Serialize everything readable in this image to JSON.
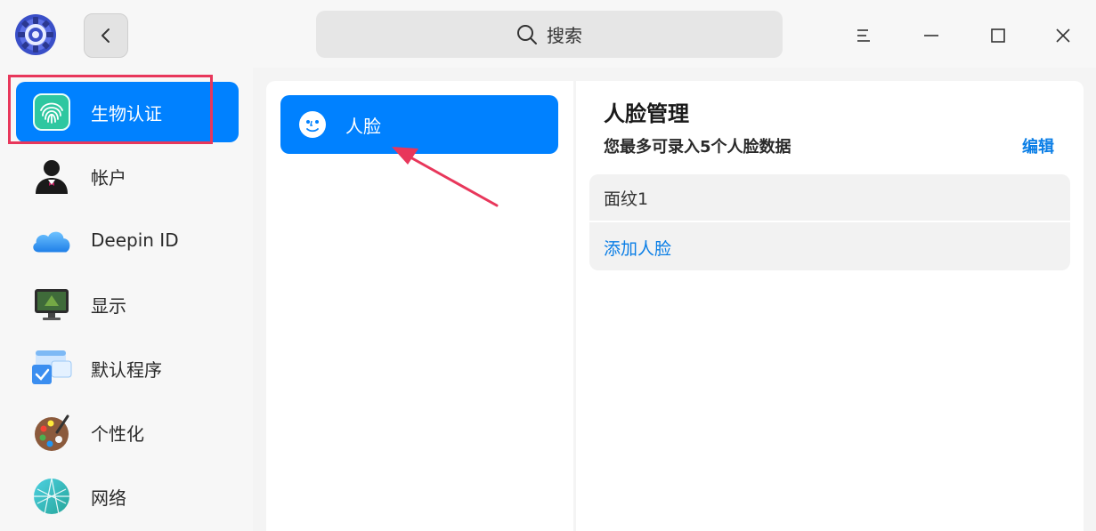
{
  "titlebar": {
    "app_icon": "settings-gear-icon",
    "back_icon": "chevron-left-icon",
    "search_icon": "search-icon",
    "search_placeholder": "搜索",
    "menu_icon": "hamburger-menu-icon",
    "minimize_icon": "minimize-icon",
    "maximize_icon": "maximize-icon",
    "close_icon": "close-icon"
  },
  "sidebar": {
    "items": [
      {
        "label": "生物认证",
        "icon": "fingerprint-icon",
        "active": true
      },
      {
        "label": "帐户",
        "icon": "user-avatar-icon",
        "active": false
      },
      {
        "label": "Deepin ID",
        "icon": "cloud-icon",
        "active": false
      },
      {
        "label": "显示",
        "icon": "monitor-icon",
        "active": false
      },
      {
        "label": "默认程序",
        "icon": "default-apps-icon",
        "active": false
      },
      {
        "label": "个性化",
        "icon": "palette-icon",
        "active": false
      },
      {
        "label": "网络",
        "icon": "network-icon",
        "active": false
      }
    ]
  },
  "middle": {
    "items": [
      {
        "label": "人脸",
        "icon": "face-icon",
        "active": true
      }
    ]
  },
  "right": {
    "title": "人脸管理",
    "subtitle": "您最多可录入5个人脸数据",
    "edit_label": "编辑",
    "faces": [
      "面纹1"
    ],
    "add_label": "添加人脸"
  },
  "colors": {
    "accent": "#0081ff",
    "link": "#0a7ee6",
    "annotation": "#e8375b"
  }
}
